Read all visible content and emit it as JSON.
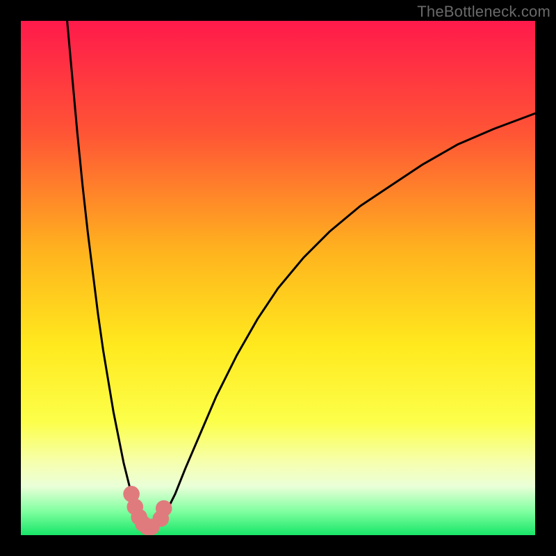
{
  "watermark": {
    "text": "TheBottleneck.com"
  },
  "chart_data": {
    "type": "line",
    "title": "",
    "xlabel": "",
    "ylabel": "",
    "xlim": [
      0,
      100
    ],
    "ylim": [
      0,
      100
    ],
    "grid": false,
    "legend": false,
    "annotations": [],
    "gradient_stops": [
      {
        "pos": 0,
        "color": "#ff1a4b"
      },
      {
        "pos": 0.22,
        "color": "#ff5535"
      },
      {
        "pos": 0.45,
        "color": "#ffb41e"
      },
      {
        "pos": 0.63,
        "color": "#ffe91e"
      },
      {
        "pos": 0.78,
        "color": "#fcff4a"
      },
      {
        "pos": 0.86,
        "color": "#f6ffb0"
      },
      {
        "pos": 0.905,
        "color": "#eaffd8"
      },
      {
        "pos": 0.955,
        "color": "#7dff9f"
      },
      {
        "pos": 1.0,
        "color": "#17e567"
      }
    ],
    "series": [
      {
        "name": "left-branch",
        "x": [
          9,
          10,
          11,
          12,
          13,
          14,
          15,
          16,
          17,
          18,
          19,
          20,
          21,
          22,
          23
        ],
        "y": [
          100,
          89,
          78,
          68,
          59,
          51,
          43,
          36,
          30,
          24,
          19,
          14,
          10,
          6,
          3
        ]
      },
      {
        "name": "right-branch",
        "x": [
          27,
          28,
          30,
          32,
          35,
          38,
          42,
          46,
          50,
          55,
          60,
          66,
          72,
          78,
          85,
          92,
          100
        ],
        "y": [
          2,
          4,
          8,
          13,
          20,
          27,
          35,
          42,
          48,
          54,
          59,
          64,
          68,
          72,
          76,
          79,
          82
        ]
      }
    ],
    "markers": {
      "name": "highlight-dots",
      "color": "#e07b7d",
      "radius_pct": 1.6,
      "points": [
        {
          "x": 21.5,
          "y": 8
        },
        {
          "x": 22.2,
          "y": 5.5
        },
        {
          "x": 23.0,
          "y": 3.5
        },
        {
          "x": 23.8,
          "y": 2.2
        },
        {
          "x": 24.6,
          "y": 1.6
        },
        {
          "x": 25.4,
          "y": 1.6
        },
        {
          "x": 27.2,
          "y": 3.2
        },
        {
          "x": 27.8,
          "y": 5.2
        }
      ]
    }
  }
}
